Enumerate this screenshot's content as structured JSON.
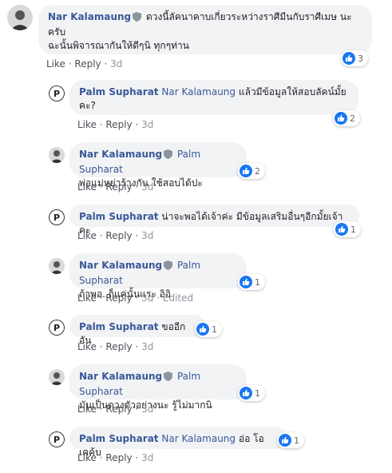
{
  "actions": {
    "like": "Like",
    "reply": "Reply",
    "dot": "·",
    "edited": "· Edited"
  },
  "comments": [
    {
      "author": "Nar Kalamaung",
      "verified": true,
      "tag": "",
      "lines": [
        "ดวงนี้ลัคนาคาบเกี่ยวระหว่างราศีมีนกับราศีเมษ นะ",
        "ครับ",
        "ฉะนั้นพิจารณากันให้ดีๆนิ ทุกๆท่าน"
      ],
      "time": "3d",
      "reactions": "3",
      "edited": false
    },
    {
      "author": "Palm Supharat",
      "verified": false,
      "tag": "Nar Kalamaung",
      "lines": [
        "แล้วมีข้อมูลให้สอบลัคน์มั้ย",
        "คะ?"
      ],
      "time": "3d",
      "reactions": "2",
      "edited": false
    },
    {
      "author": "Nar Kalamaung",
      "verified": true,
      "tag": "Palm Supharat",
      "lines": [
        "พ่อแม่หย่าร้างกัน ใช้สอบได้ปะ"
      ],
      "time": "3d",
      "reactions": "2",
      "edited": false
    },
    {
      "author": "Palm Supharat",
      "verified": false,
      "tag": "",
      "lines": [
        "น่าจะพอได้เจ้าค่ะ มีข้อมูลเสริมอื่นๆอีกมั้ยเจ้าคะ"
      ],
      "time": "3d",
      "reactions": "1",
      "edited": false
    },
    {
      "author": "Nar Kalamaung",
      "verified": true,
      "tag": "Palm Supharat",
      "lines": [
        "ถ้าพอ..ก็แค่นั้นแระ อิอิ"
      ],
      "time": "3d",
      "reactions": "1",
      "edited": true
    },
    {
      "author": "Palm Supharat",
      "verified": false,
      "tag": "",
      "lines": [
        "ขออีกอัน"
      ],
      "time": "3d",
      "reactions": "1",
      "edited": false
    },
    {
      "author": "Nar Kalamaung",
      "verified": true,
      "tag": "Palm Supharat",
      "lines": [
        "มันเป็นดวงตัวอย่างนะ รู้ไม่มากนิ"
      ],
      "time": "3d",
      "reactions": "1",
      "edited": false
    },
    {
      "author": "Palm Supharat",
      "verified": false,
      "tag": "Nar Kalamaung",
      "lines": [
        "อ่อ โอเคค้บ"
      ],
      "time": "3d",
      "reactions": "1",
      "edited": false
    }
  ],
  "icons": {
    "verified": "shield-icon",
    "reaction": "like-reaction-icon",
    "avatar_palm": "letter-p-logo"
  },
  "colors": {
    "name": "#385898",
    "like": "#1877f2",
    "bubble": "#f2f3f5"
  }
}
